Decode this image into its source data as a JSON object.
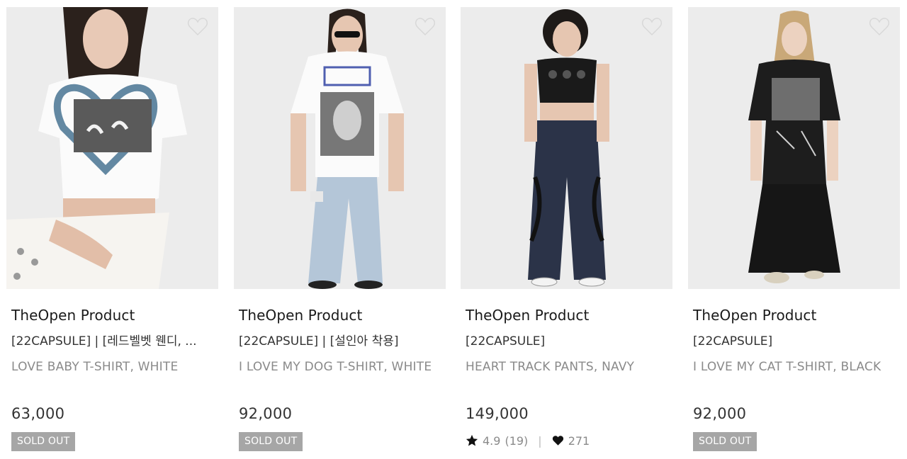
{
  "products": [
    {
      "brand": "TheOpen Product",
      "name_line1": "[22CAPSULE] | [레드벨벳 웬디, ...",
      "name_line2": "LOVE BABY T-SHIRT, WHITE",
      "price": "63,000",
      "badge": "SOLD OUT",
      "wish_icon": "heart-outline-icon"
    },
    {
      "brand": "TheOpen Product",
      "name_line1": "[22CAPSULE] | [설인아 착용]",
      "name_line2": "I LOVE MY DOG T-SHIRT, WHITE",
      "price": "92,000",
      "badge": "SOLD OUT",
      "wish_icon": "heart-outline-icon"
    },
    {
      "brand": "TheOpen Product",
      "name_line1": "[22CAPSULE]",
      "name_line2": "HEART TRACK PANTS, NAVY",
      "price": "149,000",
      "rating": "4.9",
      "review_count": "(19)",
      "likes": "271",
      "wish_icon": "heart-outline-icon"
    },
    {
      "brand": "TheOpen Product",
      "name_line1": "[22CAPSULE]",
      "name_line2": "I LOVE MY CAT T-SHIRT, BLACK",
      "price": "92,000",
      "badge": "SOLD OUT",
      "wish_icon": "heart-outline-icon"
    }
  ],
  "colors": {
    "badge_bg": "#a6a6a6",
    "text_primary": "#1a1a1a",
    "text_secondary": "#8a8a8a"
  }
}
